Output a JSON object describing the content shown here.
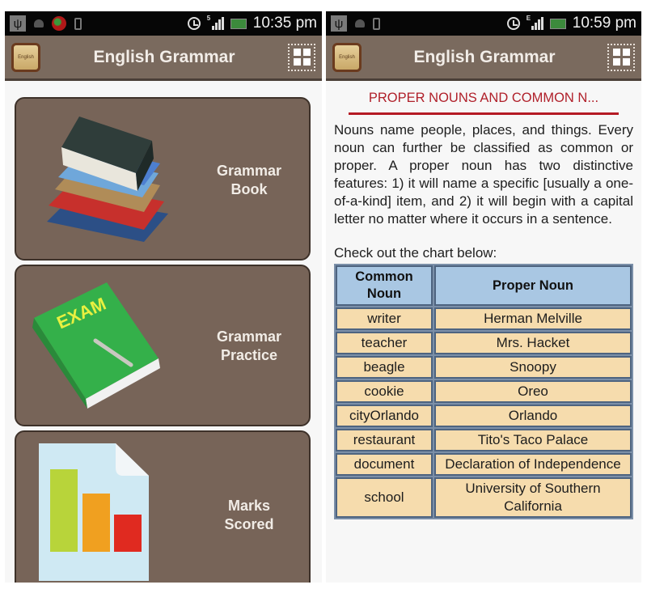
{
  "screens": {
    "left": {
      "status_bar": {
        "time": "10:35 pm",
        "icons": [
          "usb-icon",
          "android-icon",
          "notification-app-icon",
          "phone-icon",
          "alarm-icon",
          "signal-icon",
          "battery-icon"
        ],
        "network_label": "5"
      },
      "action_bar": {
        "app_icon_text": "English",
        "title": "English Grammar",
        "menu_icon": "grid-menu-icon"
      },
      "menu": [
        {
          "line1": "Grammar",
          "line2": "Book",
          "icon": "books-stack-icon"
        },
        {
          "line1": "Grammar",
          "line2": "Practice",
          "icon": "exam-book-icon",
          "icon_text": "EXAM"
        },
        {
          "line1": "Marks",
          "line2": "Scored",
          "icon": "bar-chart-report-icon"
        }
      ]
    },
    "right": {
      "status_bar": {
        "time": "10:59 pm",
        "icons": [
          "usb-icon",
          "android-icon",
          "phone-icon",
          "alarm-icon",
          "signal-icon",
          "battery-icon"
        ],
        "network_label": "E"
      },
      "action_bar": {
        "app_icon_text": "English",
        "title": "English Grammar",
        "menu_icon": "grid-menu-icon"
      },
      "topic_title": "PROPER NOUNS AND COMMON N...",
      "paragraph": "Nouns name people, places, and things. Every noun can further be classified as common or proper. A proper noun has two distinctive features: 1) it will name a specific [usually a one-of-a-kind] item, and 2) it will begin with a capital letter no matter where it occurs in a sentence.",
      "lead_in": "Check out the chart below:",
      "table": {
        "headers": [
          "Common Noun",
          "Proper Noun"
        ],
        "rows": [
          [
            "writer",
            "Herman Melville"
          ],
          [
            "teacher",
            "Mrs. Hacket"
          ],
          [
            "beagle",
            "Snoopy"
          ],
          [
            "cookie",
            "Oreo"
          ],
          [
            "cityOrlando",
            "Orlando"
          ],
          [
            "restaurant",
            "Tito's Taco Palace"
          ],
          [
            "document",
            "Declaration of Independence"
          ],
          [
            "school",
            "University of Southern California"
          ]
        ]
      }
    }
  },
  "colors": {
    "action_bar": "#7a6a5e",
    "card": "#776458",
    "title_red": "#b0202a",
    "table_header": "#a9c7e3",
    "table_cell": "#f6dcad"
  }
}
